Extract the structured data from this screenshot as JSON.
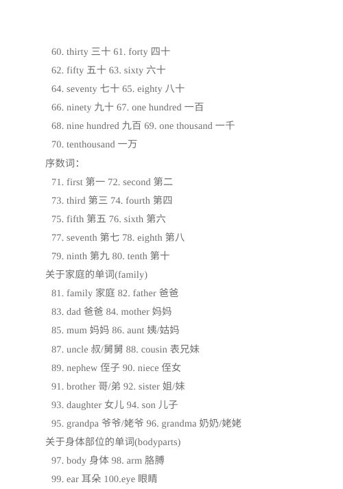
{
  "document": {
    "kind": "scanned-vocabulary-list",
    "text_color": "#6e6e70",
    "background_color": "#ffffff",
    "lines": [
      {
        "type": "item",
        "text": "60. thirty 三十 61. forty 四十"
      },
      {
        "type": "item",
        "text": "62. fifty 五十 63. sixty 六十"
      },
      {
        "type": "item",
        "text": "64. seventy 七十 65. eighty 八十"
      },
      {
        "type": "item",
        "text": "66. ninety 九十 67. one hundred 一百"
      },
      {
        "type": "item",
        "text": "68. nine hundred 九百 69. one thousand 一千"
      },
      {
        "type": "item",
        "text": "70. tenthousand 一万"
      },
      {
        "type": "header",
        "text": "序数词："
      },
      {
        "type": "item",
        "text": "71. first 第一 72. second 第二"
      },
      {
        "type": "item",
        "text": "73. third 第三 74. fourth 第四"
      },
      {
        "type": "item",
        "text": "75. fifth 第五 76. sixth 第六"
      },
      {
        "type": "item",
        "text": "77. seventh 第七 78. eighth 第八"
      },
      {
        "type": "item",
        "text": "79. ninth 第九 80. tenth 第十"
      },
      {
        "type": "header",
        "text": "关于家庭的单词(family)"
      },
      {
        "type": "item",
        "text": "81. family 家庭 82. father 爸爸"
      },
      {
        "type": "item",
        "text": "83. dad 爸爸 84. mother 妈妈"
      },
      {
        "type": "item",
        "text": "85. mum 妈妈 86. aunt 姨/姑妈"
      },
      {
        "type": "item",
        "text": "87. uncle 叔/舅舅 88. cousin 表兄妹"
      },
      {
        "type": "item",
        "text": "89. nephew 侄子 90. niece 侄女"
      },
      {
        "type": "item",
        "text": "91. brother 哥/弟 92. sister 姐/妹"
      },
      {
        "type": "item",
        "text": "93. daughter 女儿 94. son 儿子"
      },
      {
        "type": "item",
        "text": "95. grandpa 爷爷/姥爷 96. grandma 奶奶/姥姥"
      },
      {
        "type": "header",
        "text": "关于身体部位的单词(bodyparts)"
      },
      {
        "type": "item",
        "text": "97. body 身体 98. arm 胳膊"
      },
      {
        "type": "item",
        "text": "99. ear 耳朵 100.eye 眼睛"
      }
    ]
  }
}
